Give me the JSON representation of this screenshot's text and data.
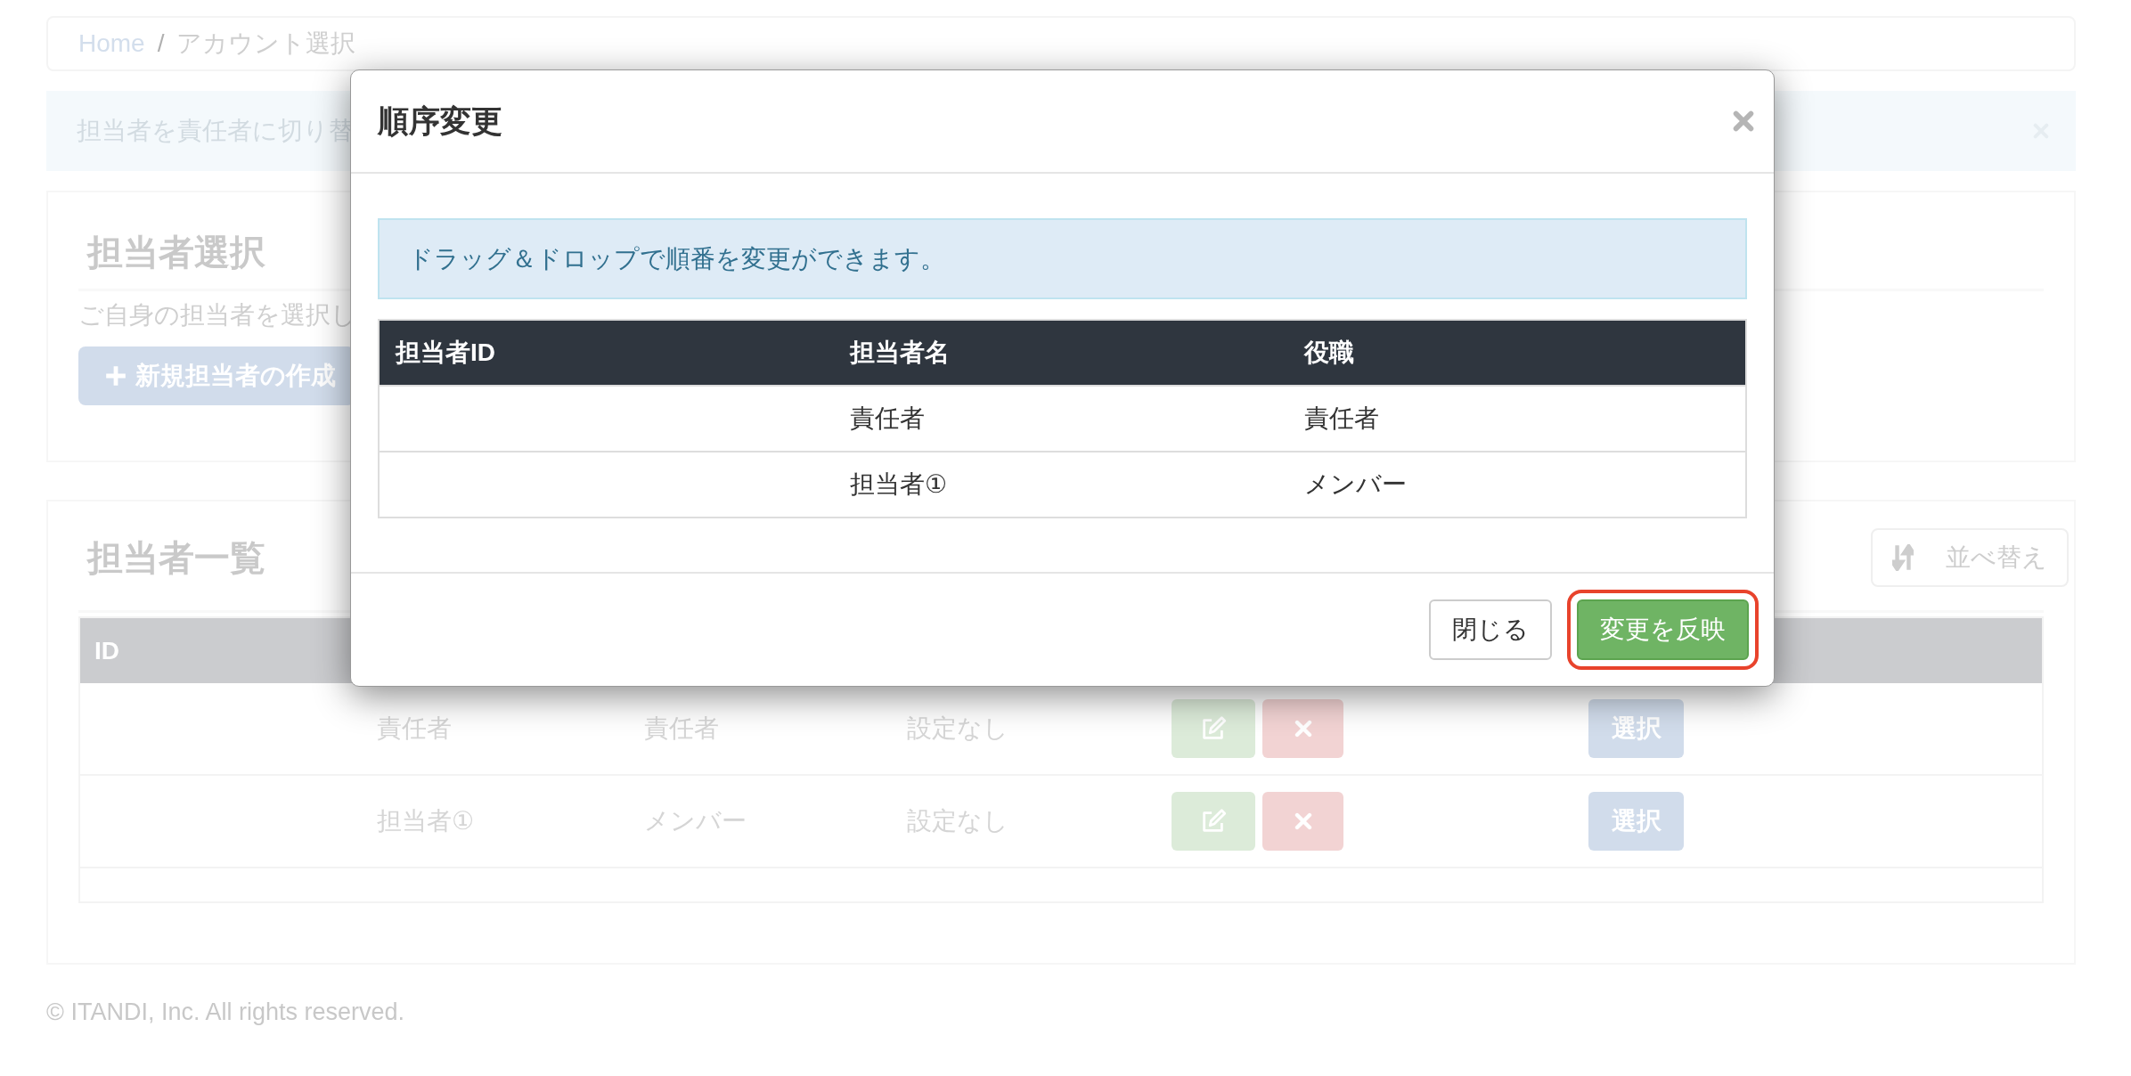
{
  "breadcrumb": {
    "items": [
      {
        "label": "Home",
        "kind": "link"
      },
      {
        "label": "アカウント選択",
        "kind": "current"
      }
    ],
    "separator": "/"
  },
  "alert": {
    "text": "担当者を責任者に切り替"
  },
  "selection_card": {
    "title": "担当者選択",
    "description": "ご自身の担当者を選択し",
    "create_button": "新規担当者の作成"
  },
  "list_card": {
    "title": "担当者一覧",
    "sort_button": "並べ替え",
    "columns": [
      "ID"
    ],
    "rows": [
      {
        "name": "責任者",
        "role": "責任者",
        "column_4": "設定なし",
        "select_button": "選択"
      },
      {
        "name": "担当者①",
        "role": "メンバー",
        "column_4": "設定なし",
        "select_button": "選択"
      }
    ]
  },
  "footer": "© ITANDI, Inc. All rights reserved.",
  "modal": {
    "title": "順序変更",
    "info": "ドラッグ＆ドロップで順番を変更ができます。",
    "columns": [
      "担当者ID",
      "担当者名",
      "役職"
    ],
    "rows": [
      {
        "name": "責任者",
        "position": "責任者"
      },
      {
        "name": "担当者①",
        "position": "メンバー"
      }
    ],
    "buttons": [
      {
        "label": "閉じる",
        "kind": "default",
        "highlighted": false
      },
      {
        "label": "変更を反映",
        "kind": "primary",
        "highlighted": true
      }
    ]
  }
}
